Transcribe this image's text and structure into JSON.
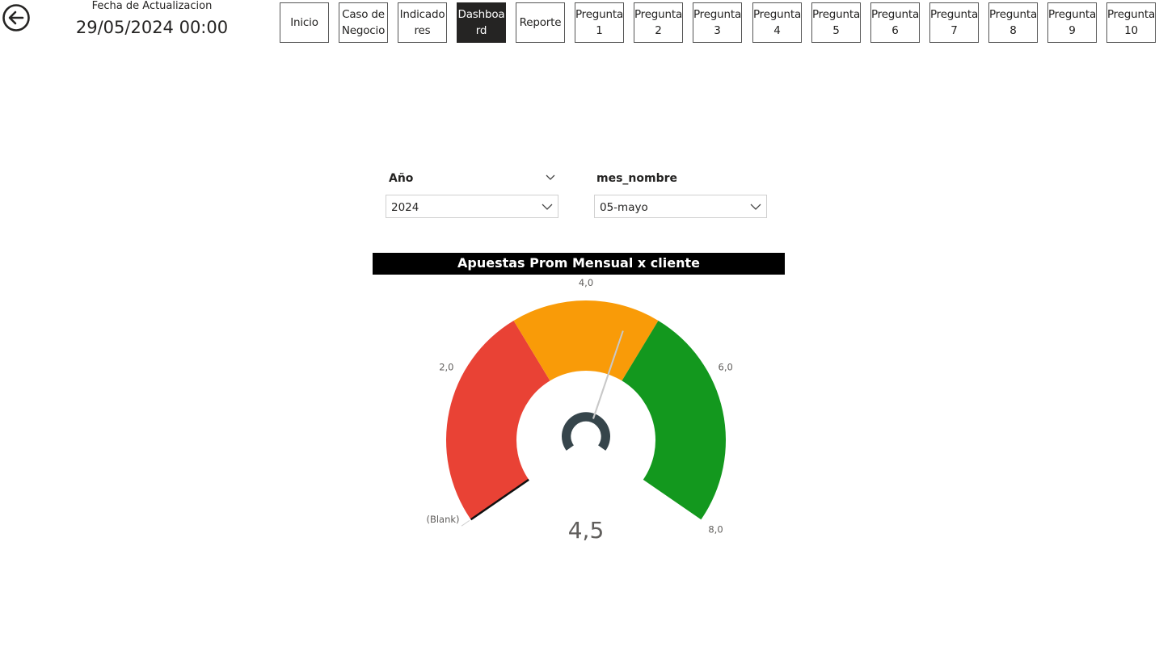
{
  "header": {
    "back_icon": "back-arrow-icon",
    "update_caption": "Fecha de Actualizacion",
    "update_value": "29/05/2024 00:00"
  },
  "nav": [
    {
      "label": "Inicio",
      "active": false
    },
    {
      "label": "Caso de\nNegocio",
      "active": false
    },
    {
      "label": "Indicado\nres",
      "active": false
    },
    {
      "label": "Dashboa\nrd",
      "active": true
    },
    {
      "label": "Reporte",
      "active": false
    },
    {
      "label": "Pregunta\n1",
      "active": false
    },
    {
      "label": "Pregunta\n2",
      "active": false
    },
    {
      "label": "Pregunta\n3",
      "active": false
    },
    {
      "label": "Pregunta\n4",
      "active": false
    },
    {
      "label": "Pregunta\n5",
      "active": false
    },
    {
      "label": "Pregunta\n6",
      "active": false
    },
    {
      "label": "Pregunta\n7",
      "active": false
    },
    {
      "label": "Pregunta\n8",
      "active": false
    },
    {
      "label": "Pregunta\n9",
      "active": false
    },
    {
      "label": "Pregunta\n10",
      "active": false
    }
  ],
  "slicers": {
    "year": {
      "title": "Año",
      "value": "2024"
    },
    "month": {
      "title": "mes_nombre",
      "value": "05-mayo"
    }
  },
  "gauge": {
    "title": "Apuestas Prom Mensual x cliente",
    "min_label": "(Blank)",
    "min": 0,
    "max": 8,
    "value": 4.5,
    "value_label": "4,5",
    "bands": [
      {
        "from": 0,
        "to": 3,
        "color": "#e94235"
      },
      {
        "from": 3,
        "to": 5,
        "color": "#f99b08"
      },
      {
        "from": 5,
        "to": 8,
        "color": "#13981e"
      }
    ],
    "ticks": [
      {
        "value": 2,
        "label": "2,0"
      },
      {
        "value": 4,
        "label": "4,0"
      },
      {
        "value": 6,
        "label": "6,0"
      },
      {
        "value": 8,
        "label": "8,0"
      }
    ],
    "target": 4.6
  }
}
